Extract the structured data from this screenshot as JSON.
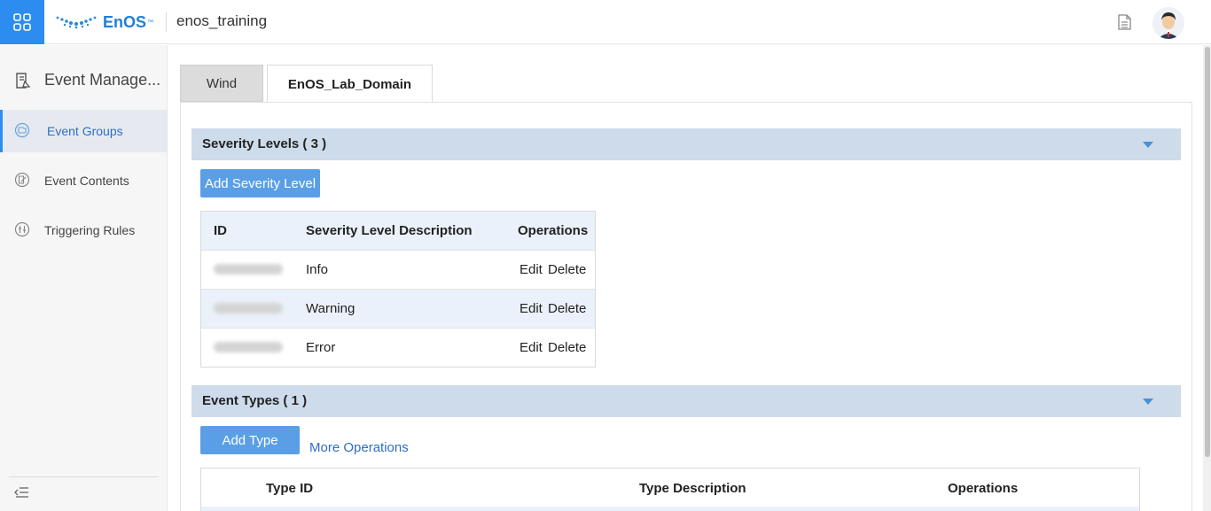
{
  "header": {
    "logo_text": "EnOS",
    "logo_tm": "™",
    "org_name": "enos_training"
  },
  "sidebar": {
    "title": "Event Manage...",
    "items": [
      {
        "label": "Event Groups",
        "active": true
      },
      {
        "label": "Event Contents",
        "active": false
      },
      {
        "label": "Triggering Rules",
        "active": false
      }
    ]
  },
  "tabs": [
    {
      "label": "Wind",
      "active": false
    },
    {
      "label": "EnOS_Lab_Domain",
      "active": true
    }
  ],
  "severity": {
    "title": "Severity Levels ( 3 )",
    "add_button": "Add Severity Level",
    "columns": [
      "ID",
      "Severity Level Description",
      "Operations"
    ],
    "rows": [
      {
        "id": "[blurred]",
        "description": "Info",
        "edit": "Edit",
        "delete": "Delete"
      },
      {
        "id": "[blurred]",
        "description": "Warning",
        "edit": "Edit",
        "delete": "Delete"
      },
      {
        "id": "[blurred]",
        "description": "Error",
        "edit": "Edit",
        "delete": "Delete"
      }
    ]
  },
  "event_types": {
    "title": "Event Types ( 1 )",
    "add_button": "Add Type",
    "more_ops": "More Operations",
    "columns": [
      "Type ID",
      "Type Description",
      "Operations"
    ]
  },
  "colors": {
    "accent": "#2d8cf0",
    "section_bar": "#cddbeb",
    "link": "#2d6fc5",
    "button": "#5a9fe6"
  }
}
